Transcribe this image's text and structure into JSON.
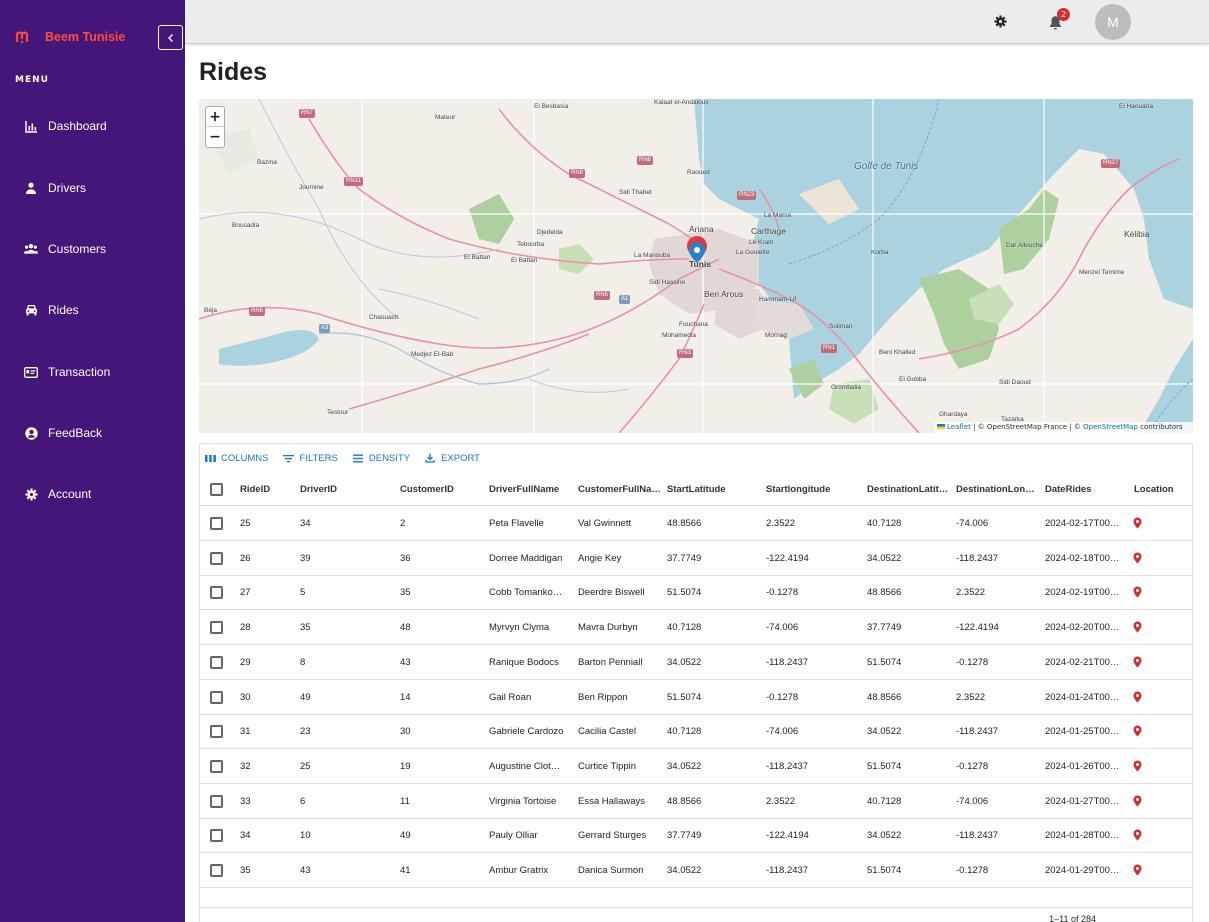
{
  "brand": {
    "logo_glyph": "m",
    "name": "Beem Tunisie",
    "color": "#ff4b3a"
  },
  "sidebar": {
    "bg_color": "#44167a",
    "menu_label": "MENU",
    "items": [
      {
        "label": "Dashboard",
        "icon": "bar-chart-icon"
      },
      {
        "label": "Drivers",
        "icon": "person-icon"
      },
      {
        "label": "Customers",
        "icon": "people-icon"
      },
      {
        "label": "Rides",
        "icon": "car-icon"
      },
      {
        "label": "Transaction",
        "icon": "card-icon"
      },
      {
        "label": "FeedBack",
        "icon": "account-circle-icon"
      },
      {
        "label": "Account",
        "icon": "gear-icon"
      }
    ]
  },
  "topbar": {
    "notifications_count": "2",
    "avatar_initial": "M"
  },
  "page": {
    "title": "Rides"
  },
  "map": {
    "zoom_in": "+",
    "zoom_out": "−",
    "attribution_leaflet": "Leaflet",
    "attribution_mid": " | © OpenStreetMap France | © ",
    "attribution_osm": "OpenStreetMap",
    "attribution_end": " contributors",
    "labels": [
      "El Besbasia",
      "Kalaat el-Andalous",
      "Mateur",
      "Golfe de Tunis",
      "Carthage",
      "La Marsa",
      "Ariana",
      "Tunis",
      "La Goulette",
      "Le Kram",
      "Ben Arous",
      "Sidi Thabet",
      "Tebourba",
      "Djedeida",
      "El Battan",
      "La Manouba",
      "Sidi Hassine",
      "Hammam-Lif",
      "Béja",
      "Medjez El-Bab",
      "Mohamedia",
      "Fouchana",
      "Mornag",
      "Grombalia",
      "Kélibia",
      "Menzel Temime",
      "Testour",
      "Bazina",
      "Joumine",
      "Bousadia",
      "Chaouach",
      "El Battan",
      "Raoued",
      "Soliman",
      "Beni Khalled",
      "El Gobba",
      "Tazarka",
      "Ghardaya",
      "Korba",
      "Dar Allouche",
      "Sidi Daoud",
      "El Haouaria"
    ],
    "road_labels": [
      "RN7",
      "RN11",
      "RN6",
      "RN5",
      "RN8",
      "RN23",
      "RN27",
      "RN3",
      "RN1",
      "A1",
      "A3",
      "RN9"
    ]
  },
  "grid": {
    "toolbar": [
      "COLUMNS",
      "FILTERS",
      "DENSITY",
      "EXPORT"
    ],
    "columns": [
      "RideID",
      "DriverID",
      "CustomerID",
      "DriverFullName",
      "CustomerFullNa…",
      "StartLatitude",
      "Startlongitude",
      "DestinationLatit…",
      "DestinationLon…",
      "DateRides",
      "Location"
    ],
    "rows": [
      [
        "25",
        "34",
        "2",
        "Peta Flavelle",
        "Val Gwinnett",
        "48.8566",
        "2.3522",
        "40.7128",
        "-74.006",
        "2024-02-17T00…"
      ],
      [
        "26",
        "39",
        "36",
        "Dorree Maddigan",
        "Angie Key",
        "37.7749",
        "-122.4194",
        "34.0522",
        "-118.2437",
        "2024-02-18T00…"
      ],
      [
        "27",
        "5",
        "35",
        "Cobb Tomanko…",
        "Deerdre Biswell",
        "51.5074",
        "-0.1278",
        "48.8566",
        "2.3522",
        "2024-02-19T00…"
      ],
      [
        "28",
        "35",
        "48",
        "Myrvyn Clyma",
        "Mavra Durbyn",
        "40.7128",
        "-74.006",
        "37.7749",
        "-122.4194",
        "2024-02-20T00…"
      ],
      [
        "29",
        "8",
        "43",
        "Ranique Bodocs",
        "Barton Penniall",
        "34.0522",
        "-118.2437",
        "51.5074",
        "-0.1278",
        "2024-02-21T00…"
      ],
      [
        "30",
        "49",
        "14",
        "Gail Roan",
        "Ben Rippon",
        "51.5074",
        "-0.1278",
        "48.8566",
        "2.3522",
        "2024-01-24T00…"
      ],
      [
        "31",
        "23",
        "30",
        "Gabriele Cardozo",
        "Cacilia Castel",
        "40.7128",
        "-74.006",
        "34.0522",
        "-118.2437",
        "2024-01-25T00…"
      ],
      [
        "32",
        "25",
        "19",
        "Augustine Clot…",
        "Curtice Tippin",
        "34.0522",
        "-118.2437",
        "51.5074",
        "-0.1278",
        "2024-01-26T00…"
      ],
      [
        "33",
        "6",
        "11",
        "Virginia Tortoise",
        "Essa Hallaways",
        "48.8566",
        "2.3522",
        "40.7128",
        "-74.006",
        "2024-01-27T00…"
      ],
      [
        "34",
        "10",
        "49",
        "Pauly Olliar",
        "Gerrard Sturges",
        "37.7749",
        "-122.4194",
        "34.0522",
        "-118.2437",
        "2024-01-28T00…"
      ],
      [
        "35",
        "43",
        "41",
        "Ambur Gratrix",
        "Danica Surmon",
        "34.0522",
        "-118.2437",
        "51.5074",
        "-0.1278",
        "2024-01-29T00…"
      ]
    ],
    "pagination": "1–11 of 284",
    "location_icon": "location-pin-icon"
  },
  "colors": {
    "accent": "#1976d2",
    "pin": "#d32f2f",
    "sea": "#aad3df"
  }
}
